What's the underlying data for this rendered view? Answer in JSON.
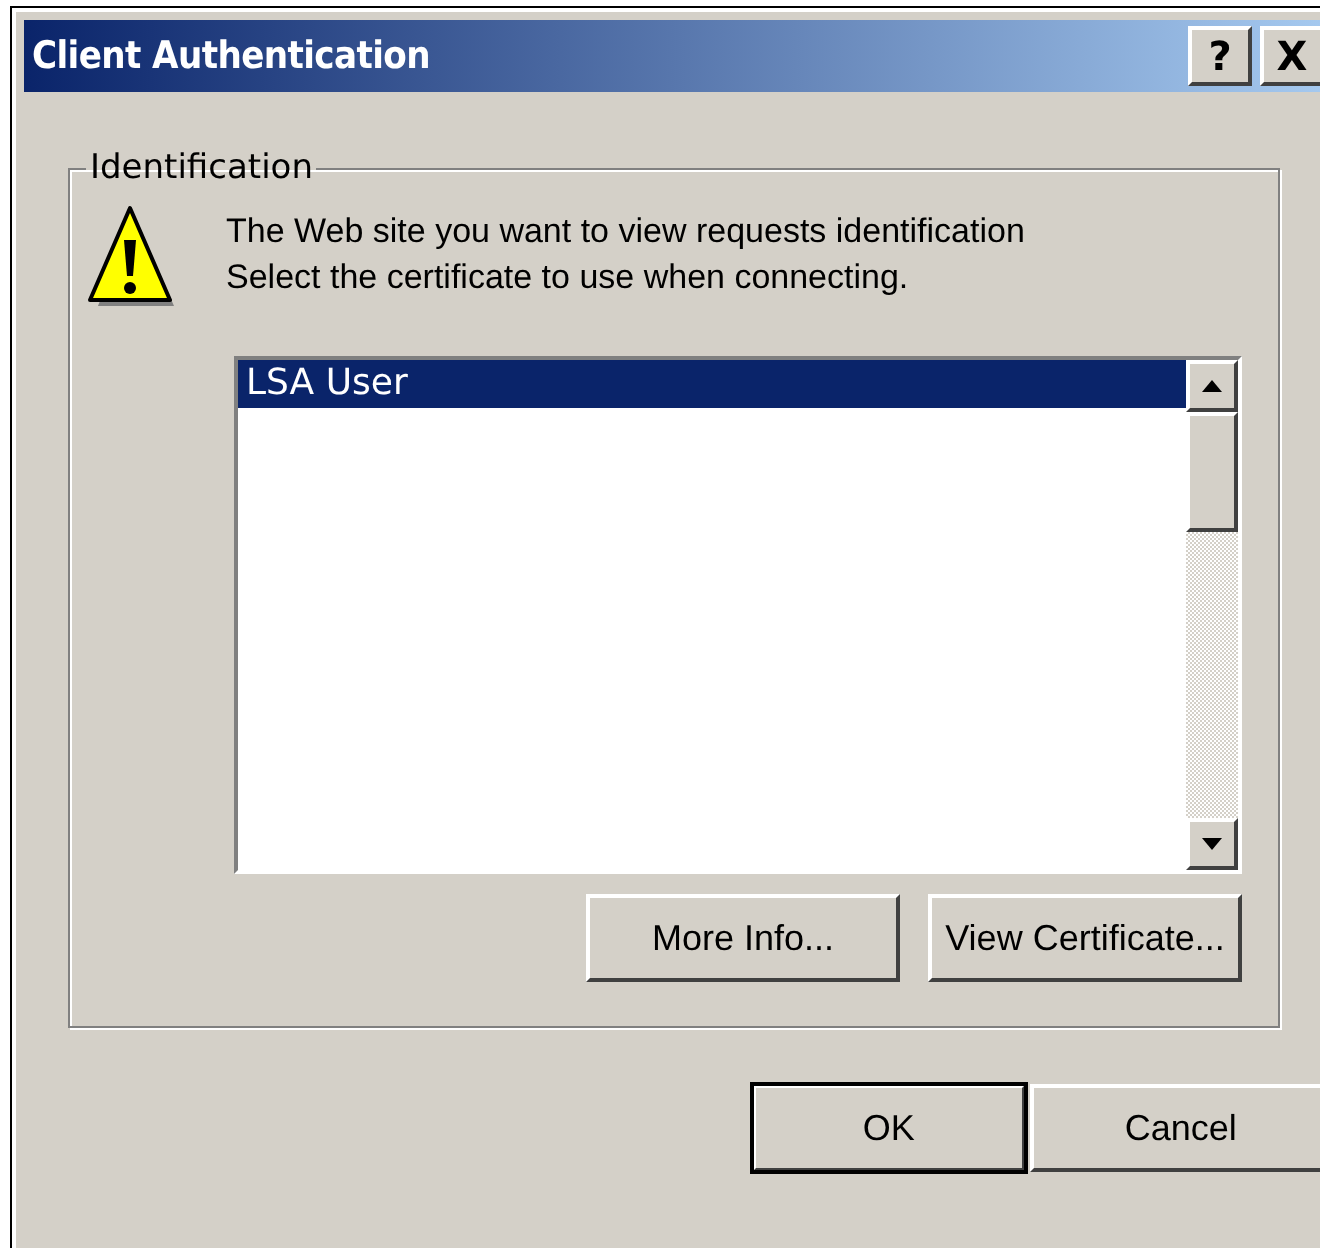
{
  "window": {
    "title": "Client Authentication",
    "controls": [
      "?",
      "X"
    ]
  },
  "group": {
    "label": "Identification",
    "message": [
      "The Web site you want to view requests identification",
      "Select the certificate to use when connecting."
    ],
    "certificates": [
      {
        "name": "LSA User",
        "selected": true
      }
    ],
    "buttons": [
      "More Info...",
      "View Certificate..."
    ]
  },
  "buttons": [
    {
      "label": "OK",
      "default": true
    },
    {
      "label": "Cancel",
      "default": false
    }
  ]
}
